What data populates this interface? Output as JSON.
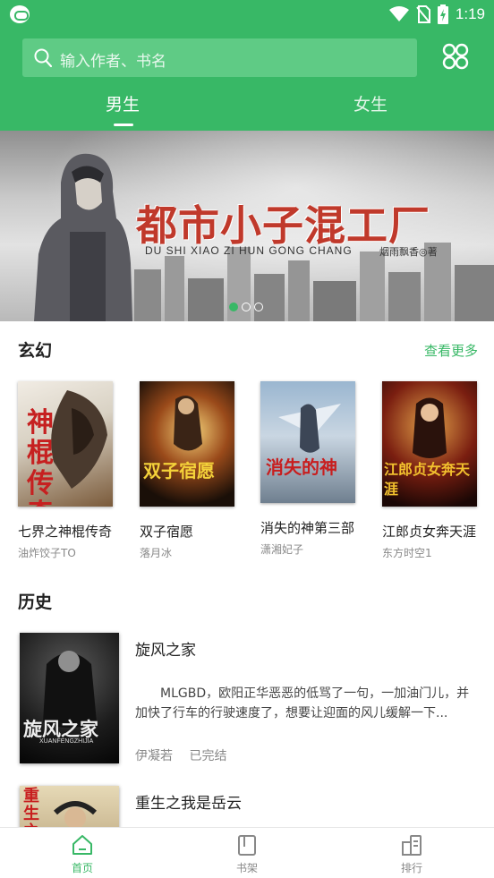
{
  "status_bar": {
    "time": "1:19"
  },
  "header": {
    "search_placeholder": "输入作者、书名",
    "tabs": [
      {
        "label": "男生",
        "active": true
      },
      {
        "label": "女生",
        "active": false
      }
    ]
  },
  "banner": {
    "title": "都市小子混工厂",
    "subtitle": "DU SHI XIAO ZI HUN GONG CHANG",
    "author": "烟雨飘香◎著",
    "dots": 3,
    "active_dot": 0
  },
  "section": {
    "title": "玄幻",
    "more_label": "查看更多",
    "books": [
      {
        "title": "七界之神棍传奇",
        "author": "油炸饺子TO",
        "cover_text": "神棍传奇"
      },
      {
        "title": "双子宿愿",
        "author": "落月冰",
        "cover_text": "双子宿愿"
      },
      {
        "title": "消失的神第三部",
        "author": "潇湘妃子",
        "cover_text": "消失的神"
      },
      {
        "title": "江郎贞女奔天涯",
        "author": "东方时空1",
        "cover_text": "江郎贞女奔天涯"
      }
    ]
  },
  "history": {
    "title": "历史",
    "items": [
      {
        "title": "旋风之家",
        "description": "MLGBD，欧阳正华恶恶的低骂了一句，一加油门儿，并加快了行车的行驶速度了，想要让迎面的风儿缓解一下...",
        "author": "伊凝若",
        "status": "已完结",
        "cover_text": "旋风之家",
        "cover_sub": "XUANFENGZHIJIA"
      },
      {
        "title": "重生之我是岳云",
        "cover_text": "重生之"
      }
    ]
  },
  "bottom_nav": [
    {
      "label": "首页",
      "icon": "home-icon",
      "active": true
    },
    {
      "label": "书架",
      "icon": "bookshelf-icon",
      "active": false
    },
    {
      "label": "排行",
      "icon": "ranking-icon",
      "active": false
    }
  ],
  "colors": {
    "primary": "#38b866",
    "search_bg": "#5fcb85"
  }
}
